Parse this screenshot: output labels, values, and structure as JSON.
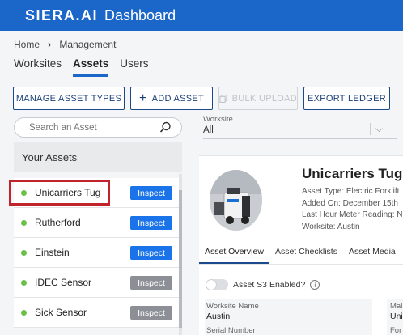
{
  "header": {
    "logo": "SIERA.AI",
    "title": "Dashboard"
  },
  "breadcrumb": {
    "home": "Home",
    "current": "Management"
  },
  "tabs": [
    {
      "label": "Worksites",
      "active": false
    },
    {
      "label": "Assets",
      "active": true
    },
    {
      "label": "Users",
      "active": false
    }
  ],
  "toolbar": {
    "manage_types": "MANAGE ASSET TYPES",
    "add_asset": "ADD ASSET",
    "bulk_upload": "BULK UPLOAD",
    "export_ledger": "EXPORT LEDGER"
  },
  "search": {
    "placeholder": "Search an Asset"
  },
  "sidebar": {
    "heading": "Your Assets"
  },
  "assets": [
    {
      "name": "Unicarriers Tug",
      "action": "Inspect",
      "action_enabled": true
    },
    {
      "name": "Rutherford",
      "action": "Inspect",
      "action_enabled": true
    },
    {
      "name": "Einstein",
      "action": "Inspect",
      "action_enabled": true
    },
    {
      "name": "IDEC Sensor",
      "action": "Inspect",
      "action_enabled": false
    },
    {
      "name": "Sick Sensor",
      "action": "Inspect",
      "action_enabled": false
    }
  ],
  "worksite_filter": {
    "label": "Worksite",
    "value": "All"
  },
  "detail": {
    "name": "Unicarriers Tug",
    "asset_type": "Asset Type:  Electric Forklift",
    "added_on": "Added On: December 15th",
    "hour_meter": "Last Hour Meter Reading: N",
    "worksite": "Worksite: Austin",
    "tabs": [
      "Asset Overview",
      "Asset Checklists",
      "Asset Media"
    ],
    "s3_label": "Asset S3 Enabled?",
    "info_glyph": "i",
    "fields": [
      {
        "label": "Worksite Name",
        "value": "Austin"
      },
      {
        "label": "Mal",
        "value": "Uni"
      },
      {
        "label": "Serial Number",
        "value": ""
      },
      {
        "label": "For",
        "value": ""
      }
    ]
  },
  "colors": {
    "brand": "#1a66c9",
    "status_active": "#6cc04a",
    "inspect_enabled": "#1a73e8",
    "inspect_disabled": "#8c9096",
    "highlight": "#c0232a"
  }
}
